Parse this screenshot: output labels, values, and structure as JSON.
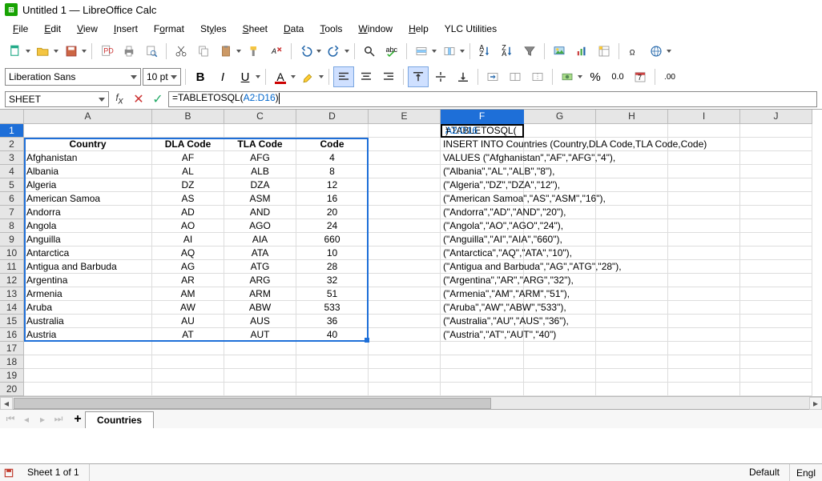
{
  "titlebar": {
    "title": "Untitled 1 — LibreOffice Calc"
  },
  "menu": [
    "File",
    "Edit",
    "View",
    "Insert",
    "Format",
    "Styles",
    "Sheet",
    "Data",
    "Tools",
    "Window",
    "Help",
    "YLC Utilities"
  ],
  "font": {
    "name": "Liberation Sans",
    "size": "10 pt"
  },
  "namebox": "SHEET",
  "formula": {
    "prefix": "=TABLETOSQL(",
    "arg": "A2:D16",
    "suffix": ")"
  },
  "columns": [
    "A",
    "B",
    "C",
    "D",
    "E",
    "F",
    "G",
    "H",
    "I",
    "J"
  ],
  "headerCol": "F",
  "selectedRow": 1,
  "table": {
    "headers": {
      "a": "Country",
      "b": "DLA Code",
      "c": "TLA Code",
      "d": "Code"
    },
    "rows": [
      {
        "r": 3,
        "a": "Afghanistan",
        "b": "AF",
        "c": "AFG",
        "d": "4"
      },
      {
        "r": 4,
        "a": "Albania",
        "b": "AL",
        "c": "ALB",
        "d": "8"
      },
      {
        "r": 5,
        "a": "Algeria",
        "b": "DZ",
        "c": "DZA",
        "d": "12"
      },
      {
        "r": 6,
        "a": "American Samoa",
        "b": "AS",
        "c": "ASM",
        "d": "16"
      },
      {
        "r": 7,
        "a": "Andorra",
        "b": "AD",
        "c": "AND",
        "d": "20"
      },
      {
        "r": 8,
        "a": "Angola",
        "b": "AO",
        "c": "AGO",
        "d": "24"
      },
      {
        "r": 9,
        "a": "Anguilla",
        "b": "AI",
        "c": "AIA",
        "d": "660"
      },
      {
        "r": 10,
        "a": "Antarctica",
        "b": "AQ",
        "c": "ATA",
        "d": "10"
      },
      {
        "r": 11,
        "a": "Antigua and Barbuda",
        "b": "AG",
        "c": "ATG",
        "d": "28"
      },
      {
        "r": 12,
        "a": "Argentina",
        "b": "AR",
        "c": "ARG",
        "d": "32"
      },
      {
        "r": 13,
        "a": "Armenia",
        "b": "AM",
        "c": "ARM",
        "d": "51"
      },
      {
        "r": 14,
        "a": "Aruba",
        "b": "AW",
        "c": "ABW",
        "d": "533"
      },
      {
        "r": 15,
        "a": "Australia",
        "b": "AU",
        "c": "AUS",
        "d": "36"
      },
      {
        "r": 16,
        "a": "Austria",
        "b": "AT",
        "c": "AUT",
        "d": "40"
      }
    ]
  },
  "sqlOutput": [
    "=TABLETOSQL(A2:D16)",
    "INSERT INTO Countries (Country,DLA Code,TLA Code,Code)",
    "VALUES (\"Afghanistan\",\"AF\",\"AFG\",\"4\"),",
    "(\"Albania\",\"AL\",\"ALB\",\"8\"),",
    "(\"Algeria\",\"DZ\",\"DZA\",\"12\"),",
    "(\"American Samoa\",\"AS\",\"ASM\",\"16\"),",
    "(\"Andorra\",\"AD\",\"AND\",\"20\"),",
    "(\"Angola\",\"AO\",\"AGO\",\"24\"),",
    "(\"Anguilla\",\"AI\",\"AIA\",\"660\"),",
    "(\"Antarctica\",\"AQ\",\"ATA\",\"10\"),",
    "(\"Antigua and Barbuda\",\"AG\",\"ATG\",\"28\"),",
    "(\"Argentina\",\"AR\",\"ARG\",\"32\"),",
    "(\"Armenia\",\"AM\",\"ARM\",\"51\"),",
    "(\"Aruba\",\"AW\",\"ABW\",\"533\"),",
    "(\"Australia\",\"AU\",\"AUS\",\"36\"),",
    "(\"Austria\",\"AT\",\"AUT\",\"40\")"
  ],
  "sheetTab": "Countries",
  "status": {
    "sheet": "Sheet 1 of 1",
    "style": "Default",
    "lang": "Engl"
  }
}
